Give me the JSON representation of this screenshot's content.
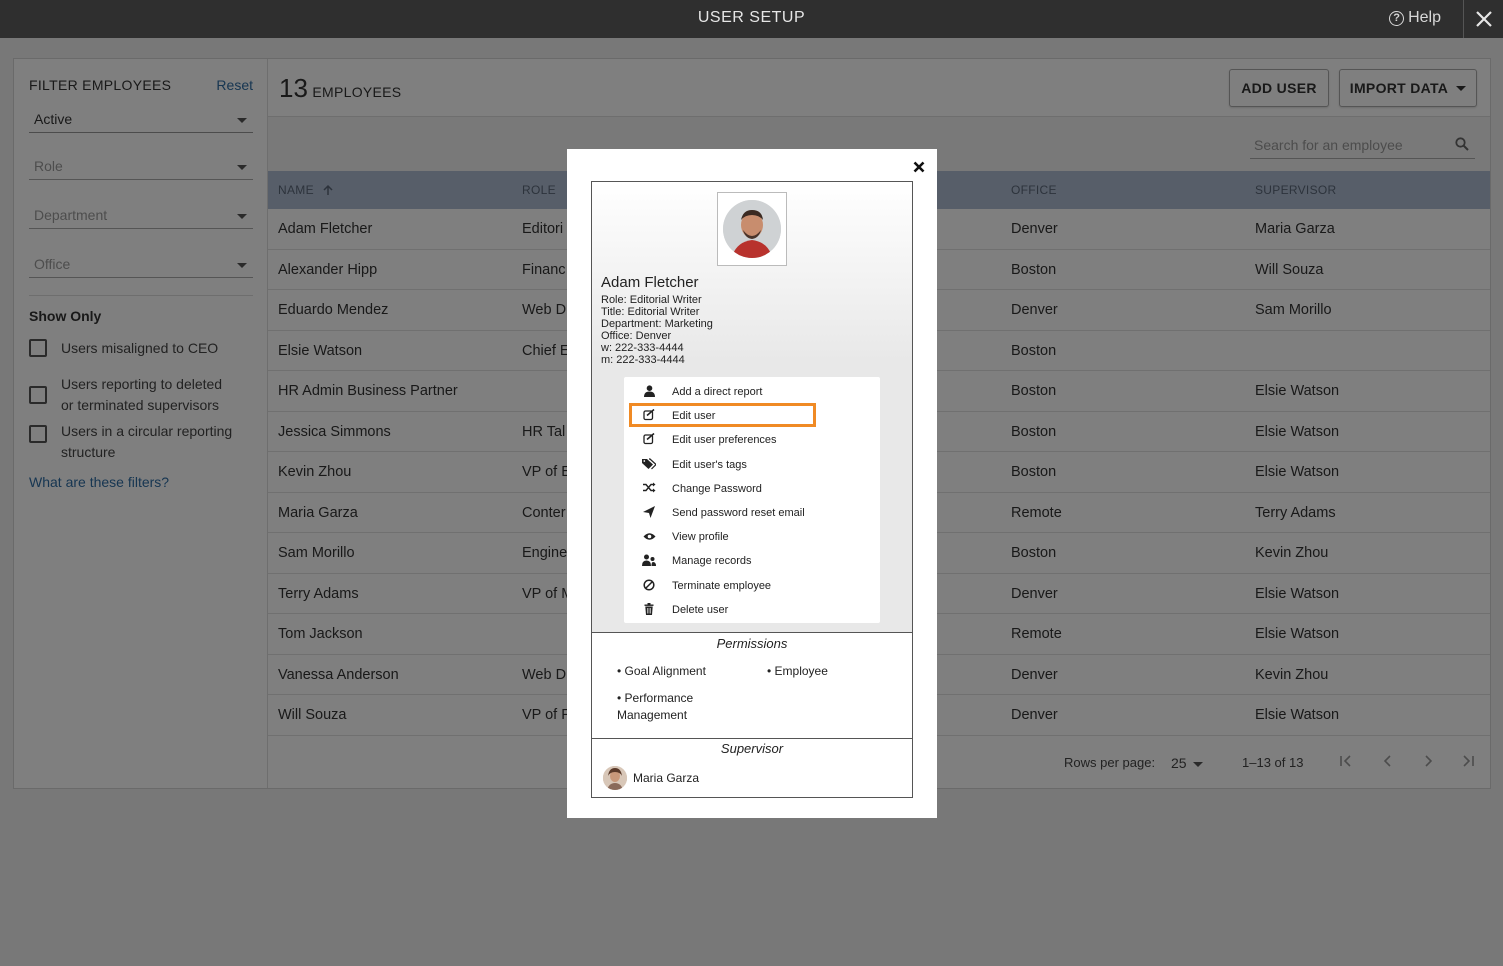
{
  "topbar": {
    "title": "USER SETUP",
    "help": "Help"
  },
  "filters": {
    "title": "FILTER EMPLOYEES",
    "reset": "Reset",
    "status": "Active",
    "role_placeholder": "Role",
    "department_placeholder": "Department",
    "office_placeholder": "Office",
    "show_only": "Show Only",
    "opt1": "Users misaligned to CEO",
    "opt2": "Users reporting to deleted or terminated supervisors",
    "opt3": "Users in a circular reporting structure",
    "help_link": "What are these filters?"
  },
  "employees": {
    "count": "13",
    "count_label": "EMPLOYEES",
    "add_user": "ADD USER",
    "import_data": "IMPORT DATA",
    "search_placeholder": "Search for an employee",
    "columns": {
      "name": "NAME",
      "role": "ROLE",
      "office": "OFFICE",
      "supervisor": "SUPERVISOR"
    },
    "rows": [
      {
        "name": "Adam Fletcher",
        "role": "Editori",
        "office": "Denver",
        "supervisor": "Maria Garza"
      },
      {
        "name": "Alexander Hipp",
        "role": "Financ",
        "office": "Boston",
        "supervisor": "Will Souza"
      },
      {
        "name": "Eduardo Mendez",
        "role": "Web D",
        "office": "Denver",
        "supervisor": "Sam Morillo"
      },
      {
        "name": "Elsie Watson",
        "role": "Chief E",
        "office": "Boston",
        "supervisor": ""
      },
      {
        "name": "HR Admin Business Partner",
        "role": "",
        "office": "Boston",
        "supervisor": "Elsie Watson"
      },
      {
        "name": "Jessica Simmons",
        "role": "HR Tal",
        "office": "Boston",
        "supervisor": "Elsie Watson"
      },
      {
        "name": "Kevin Zhou",
        "role": "VP of E",
        "office": "Boston",
        "supervisor": "Elsie Watson"
      },
      {
        "name": "Maria Garza",
        "role": "Conter",
        "office": "Remote",
        "supervisor": "Terry Adams"
      },
      {
        "name": "Sam Morillo",
        "role": "Engine",
        "office": "Boston",
        "supervisor": "Kevin Zhou"
      },
      {
        "name": "Terry Adams",
        "role": "VP of M",
        "office": "Denver",
        "supervisor": "Elsie Watson"
      },
      {
        "name": "Tom Jackson",
        "role": "",
        "office": "Remote",
        "supervisor": "Elsie Watson"
      },
      {
        "name": "Vanessa Anderson",
        "role": "Web D",
        "office": "Denver",
        "supervisor": "Kevin Zhou"
      },
      {
        "name": "Will Souza",
        "role": "VP of F",
        "office": "Denver",
        "supervisor": "Elsie Watson"
      }
    ],
    "rows_per_page_label": "Rows per page:",
    "rows_per_page": "25",
    "range": "1–13 of 13"
  },
  "modal": {
    "name": "Adam Fletcher",
    "details": [
      "Role: Editorial Writer",
      "Title: Editorial Writer",
      "Department: Marketing",
      "Office: Denver",
      "w: 222-333-4444",
      "m: 222-333-4444"
    ],
    "menu": [
      {
        "label": "Add a direct report",
        "icon": "person-icon"
      },
      {
        "label": "Edit user",
        "icon": "edit-icon"
      },
      {
        "label": "Edit user preferences",
        "icon": "edit-icon"
      },
      {
        "label": "Edit user's tags",
        "icon": "tags-icon"
      },
      {
        "label": "Change Password",
        "icon": "shuffle-icon"
      },
      {
        "label": "Send password reset email",
        "icon": "send-icon"
      },
      {
        "label": "View profile",
        "icon": "eye-icon"
      },
      {
        "label": "Manage records",
        "icon": "users-icon"
      },
      {
        "label": "Terminate employee",
        "icon": "ban-icon"
      },
      {
        "label": "Delete user",
        "icon": "trash-icon"
      }
    ],
    "permissions_title": "Permissions",
    "permissions": [
      "• Goal Alignment",
      "• Employee",
      "• Performance",
      "Management"
    ],
    "supervisor_title": "Supervisor",
    "supervisor_name": "Maria Garza",
    "highlight_color": "#f08a24"
  }
}
